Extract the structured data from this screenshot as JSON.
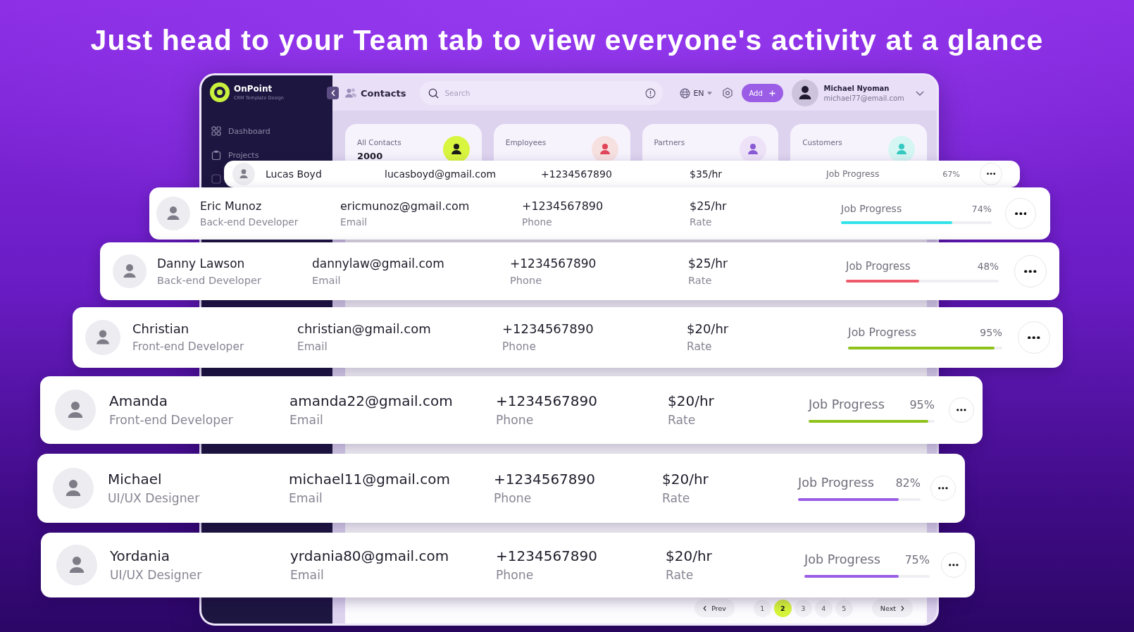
{
  "title": "Just head to your Team tab to view everyone's activity at a glance",
  "sidebar": {
    "brand": "OnPoint",
    "tagline": "CRM Template Design",
    "items": [
      {
        "label": "Dashboard"
      },
      {
        "label": "Projects"
      }
    ]
  },
  "header": {
    "title": "Contacts",
    "search": {
      "placeholder": "Search"
    },
    "language": "EN",
    "add_button": "Add",
    "user": {
      "name": "Michael Nyoman",
      "email": "michael77@email.com"
    }
  },
  "stats": [
    {
      "label": "All Contacts",
      "value": "2000",
      "color": "#d8f53f"
    },
    {
      "label": "Employees",
      "color": "#f7e0e0"
    },
    {
      "label": "Partners",
      "color": "#ede2f8"
    },
    {
      "label": "Customers",
      "color": "#d5f6f3"
    }
  ],
  "contacts": [
    {
      "name": "Lucas Boyd",
      "email": "lucasboyd@gmail.com",
      "phone": "+1234567890",
      "rate": "$35/hr",
      "progress": {
        "label": "Job Progress",
        "percent": "67%"
      }
    },
    {
      "name": "Eric Munoz",
      "role": "Back-end Developer",
      "email": "ericmunoz@gmail.com",
      "email_label": "Email",
      "phone": "+1234567890",
      "phone_label": "Phone",
      "rate": "$25/hr",
      "rate_label": "Rate",
      "progress": {
        "label": "Job Progress",
        "percent": "74%",
        "level": 0.74,
        "color": "#33e3ea"
      }
    },
    {
      "name": "Danny Lawson",
      "role": "Back-end Developer",
      "email": "dannylaw@gmail.com",
      "email_label": "Email",
      "phone": "+1234567890",
      "phone_label": "Phone",
      "rate": "$25/hr",
      "rate_label": "Rate",
      "progress": {
        "label": "Job Progress",
        "percent": "48%",
        "level": 0.48,
        "color": "#ee5a6a"
      }
    },
    {
      "name": "Christian",
      "role": "Front-end Developer",
      "email": "christian@gmail.com",
      "email_label": "Email",
      "phone": "+1234567890",
      "phone_label": "Phone",
      "rate": "$20/hr",
      "rate_label": "Rate",
      "progress": {
        "label": "Job Progress",
        "percent": "95%",
        "level": 0.95,
        "color": "#8fc21b"
      }
    },
    {
      "name": "Amanda",
      "role": "Front-end Developer",
      "email": "amanda22@gmail.com",
      "email_label": "Email",
      "phone": "+1234567890",
      "phone_label": "Phone",
      "rate": "$20/hr",
      "rate_label": "Rate",
      "progress": {
        "label": "Job Progress",
        "percent": "95%",
        "level": 0.95,
        "color": "#8fc21b"
      }
    },
    {
      "name": "Michael",
      "role": "UI/UX Designer",
      "email": "michael11@gmail.com",
      "email_label": "Email",
      "phone": "+1234567890",
      "phone_label": "Phone",
      "rate": "$20/hr",
      "rate_label": "Rate",
      "progress": {
        "label": "Job Progress",
        "percent": "82%",
        "level": 0.82,
        "color": "#9b5de5"
      }
    },
    {
      "name": "Yordania",
      "role": "UI/UX Designer",
      "email": "yrdania80@gmail.com",
      "email_label": "Email",
      "phone": "+1234567890",
      "phone_label": "Phone",
      "rate": "$20/hr",
      "rate_label": "Rate",
      "progress": {
        "label": "Job Progress",
        "percent": "75%",
        "level": 0.75,
        "color": "#9b5de5"
      }
    }
  ],
  "pagination": {
    "prev": "Prev",
    "pages": [
      {
        "label": "1",
        "selected": false
      },
      {
        "label": "2",
        "selected": true
      },
      {
        "label": "3",
        "selected": false
      },
      {
        "label": "4",
        "selected": false
      },
      {
        "label": "5",
        "selected": false
      }
    ],
    "next": "Next"
  }
}
